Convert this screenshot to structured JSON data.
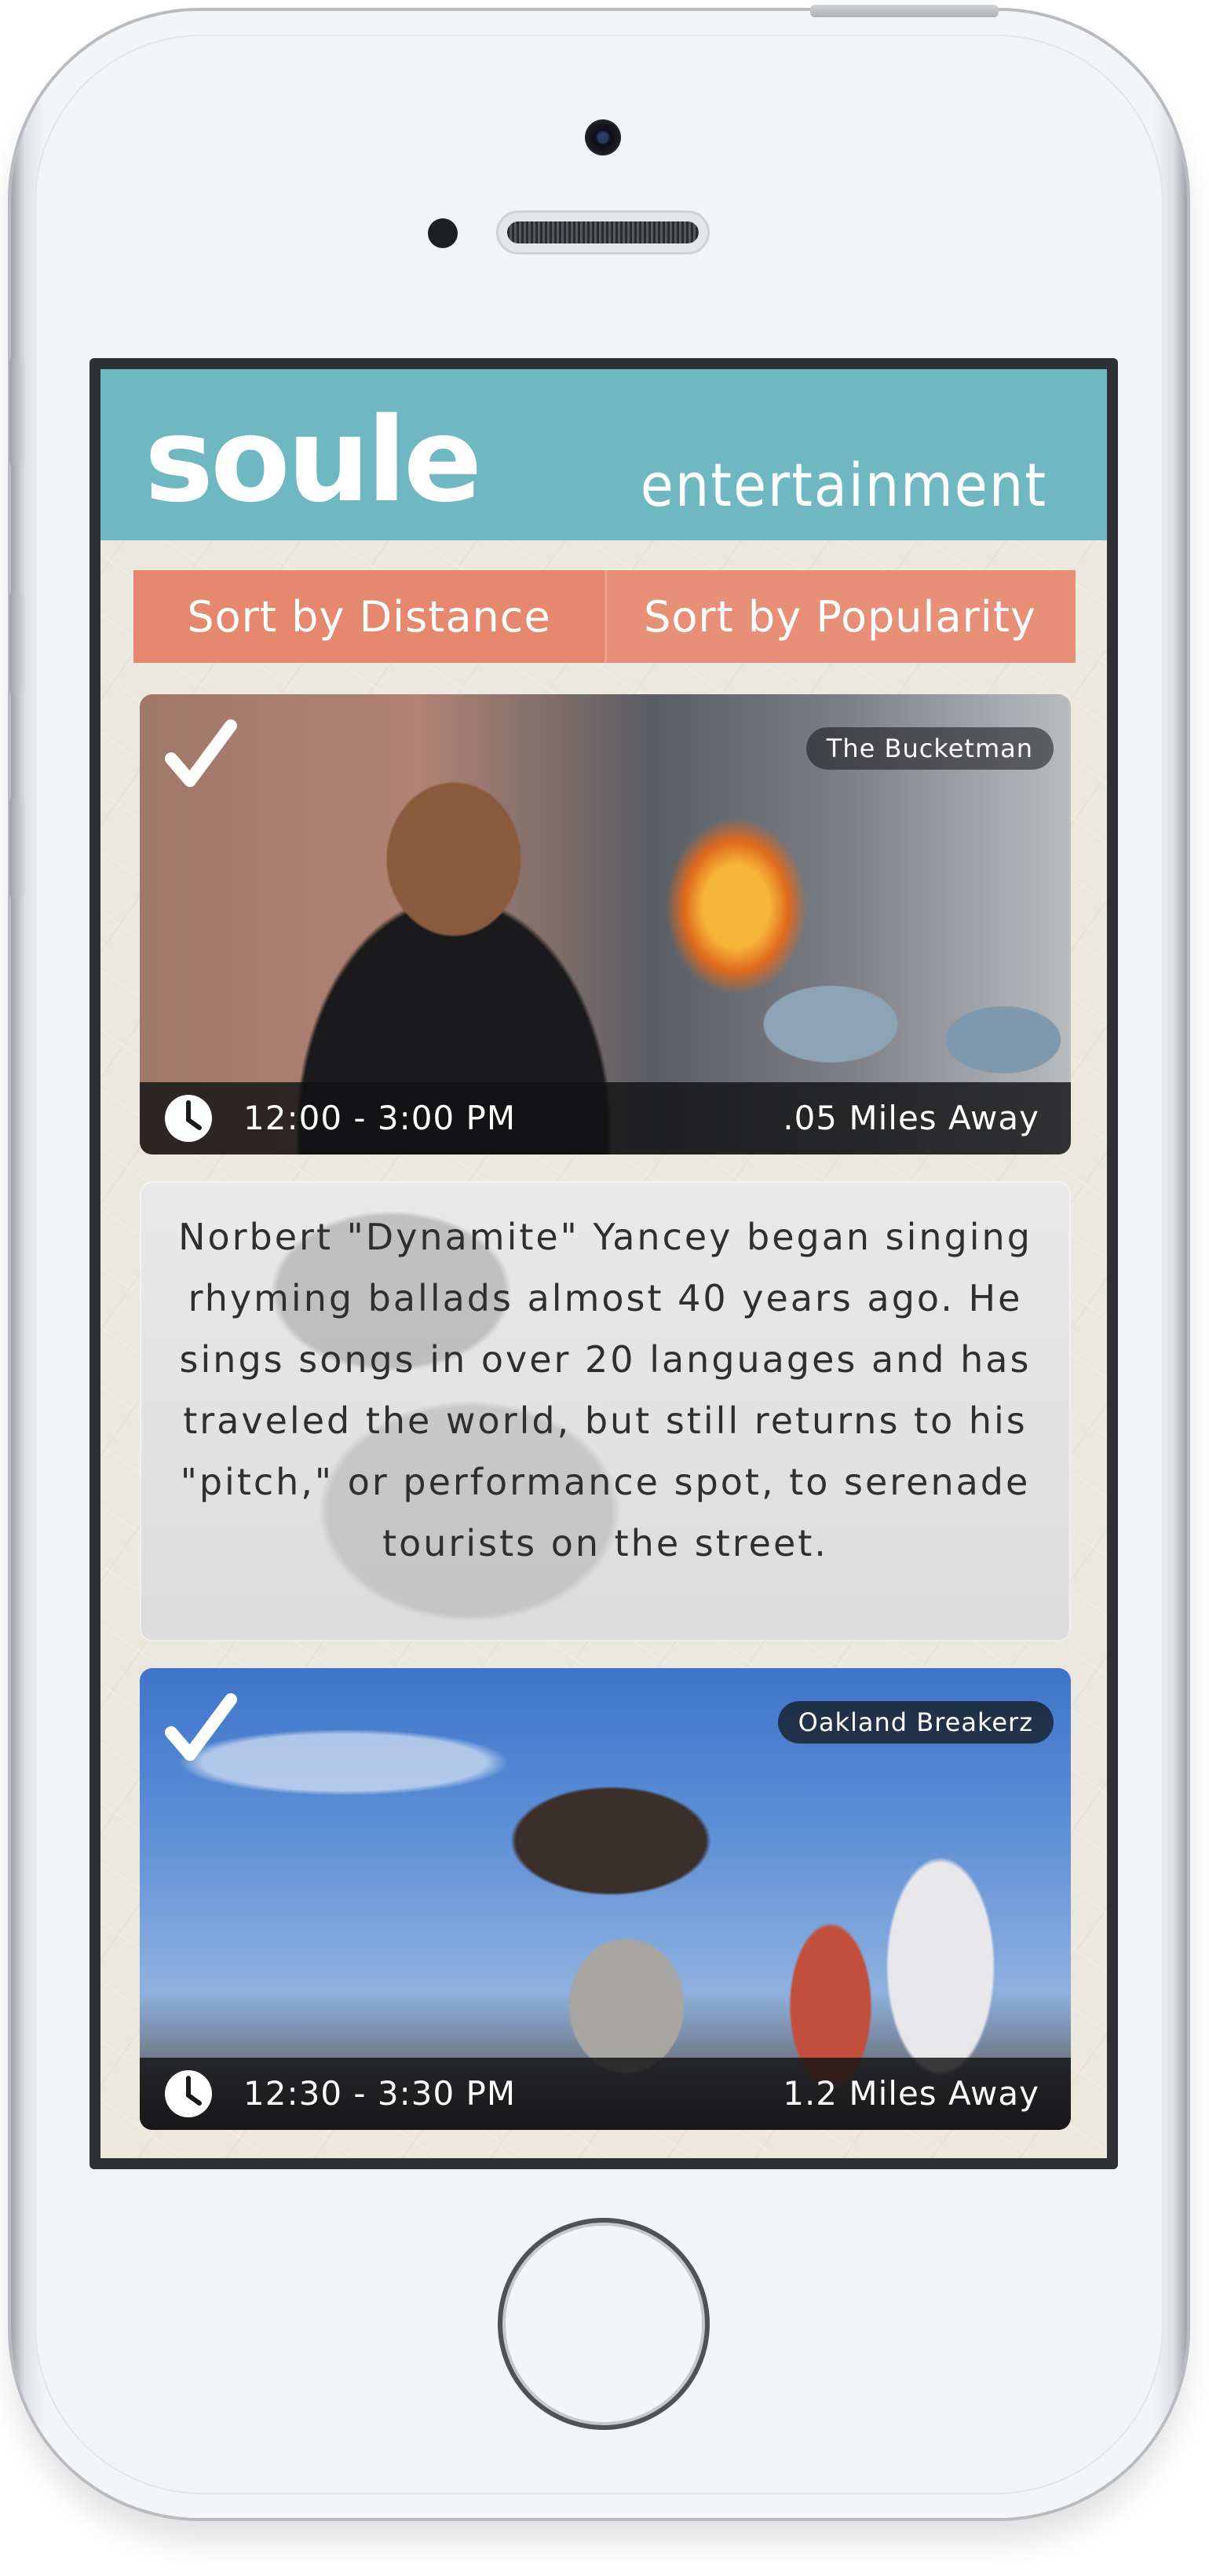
{
  "header": {
    "logo": "soule",
    "subtitle": "entertainment"
  },
  "sort": {
    "distance_label": "Sort by Distance",
    "popularity_label": "Sort by Popularity"
  },
  "performers": [
    {
      "name": "The Bucketman",
      "time": "12:00 - 3:00 PM",
      "distance": ".05 Miles Away"
    },
    {
      "name": "Oakland Breakerz",
      "time": "12:30 - 3:30 PM",
      "distance": "1.2 Miles Away"
    }
  ],
  "description": {
    "text": "Norbert \"Dynamite\" Yancey began singing rhyming ballads almost 40 years ago. He sings songs in over 20 languages and has traveled the world, but still returns to his \"pitch,\" or performance spot, to serenade tourists on the street."
  },
  "icons": {
    "check": "check-icon",
    "clock": "clock-icon"
  },
  "colors": {
    "header": "#6fb7c1",
    "sort_buttons": "#e5886d",
    "background": "#ebe8e0"
  }
}
